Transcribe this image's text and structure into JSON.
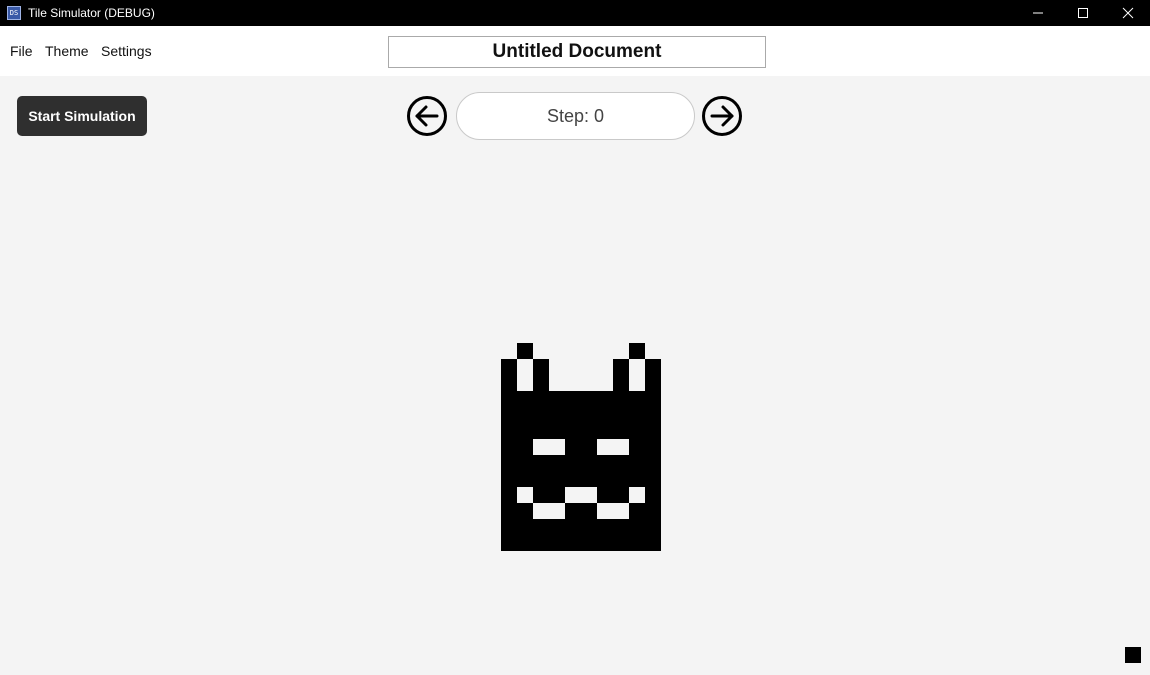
{
  "window": {
    "title": "Tile Simulator (DEBUG)",
    "icon": "app-icon",
    "icon_glyph": "DS"
  },
  "menu": {
    "file": "File",
    "theme": "Theme",
    "settings": "Settings"
  },
  "document": {
    "title": "Untitled Document"
  },
  "toolbar": {
    "start_label": "Start Simulation",
    "step_label": "Step: 0",
    "prev_icon": "arrow-left-circle-icon",
    "next_icon": "arrow-right-circle-icon"
  },
  "grid": {
    "cell_color": "#000000",
    "rows": [
      "0010000000100",
      "0110000001101",
      "1111111111111",
      "1111111111111",
      "1111111111111",
      "1111111111111",
      "1111111111111",
      "1111111111111",
      "1111111111111",
      "1111111111111",
      "1111111111111",
      "1111111111111",
      "1111111111111"
    ],
    "holes": [
      "01",
      "02",
      "1-1",
      "1-2",
      "1-8",
      "1-9",
      "2-1",
      "2-8",
      "6-2",
      "6-3",
      "6-6",
      "6-7",
      "9-1",
      "9-4",
      "9-5",
      "9-8",
      "10-2",
      "10-3",
      "10-6",
      "10-7"
    ]
  },
  "colors": {
    "titlebar": "#000000",
    "accent_button": "#2f2f2f",
    "background": "#f4f4f4"
  }
}
